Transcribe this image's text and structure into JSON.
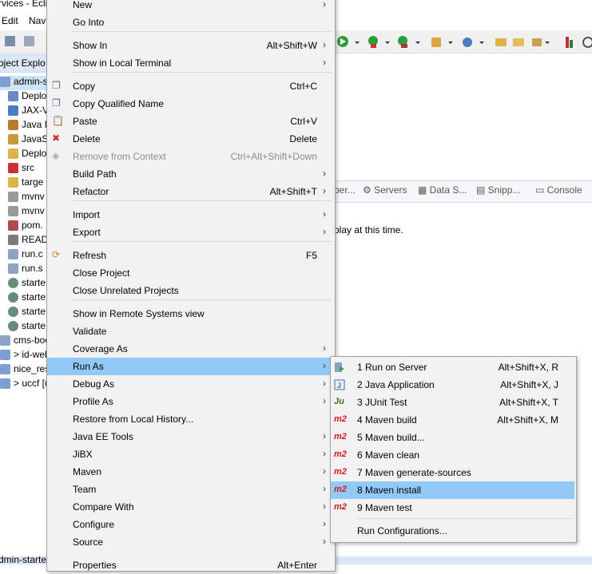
{
  "window": {
    "title": "rvices - Ecli"
  },
  "menubar": {
    "items": [
      "Edit",
      "Nav"
    ]
  },
  "explorer": {
    "title": "oject Explo",
    "rows": [
      "admin-st",
      "Deplo",
      "JAX-V",
      "Java I",
      "JavaS",
      "Deplo",
      "src",
      "targe",
      "mvnv",
      "mvnv",
      "pom.",
      "READ",
      "run.c",
      "run.s",
      "starte",
      "starte",
      "starte",
      "starte",
      "cms-boo",
      "> id-web",
      "nice_rest",
      "> uccf [u"
    ],
    "bottom_row": "dmin-starte"
  },
  "bottom_panel": {
    "tabs": [
      "per...",
      "Servers",
      "Data S...",
      "Snipp...",
      "Console"
    ],
    "message": "play at this time."
  },
  "context_menu": {
    "items": [
      {
        "label": "New",
        "submenu": true
      },
      {
        "label": "Go Into"
      },
      {
        "label": "Show In",
        "accel": "Alt+Shift+W",
        "submenu": true
      },
      {
        "label": "Show in Local Terminal",
        "submenu": true
      },
      {
        "label": "Copy",
        "accel": "Ctrl+C",
        "icon": "copy-icon"
      },
      {
        "label": "Copy Qualified Name",
        "icon": "copy-icon"
      },
      {
        "label": "Paste",
        "accel": "Ctrl+V",
        "icon": "paste-icon"
      },
      {
        "label": "Delete",
        "accel": "Delete",
        "icon": "delete-icon"
      },
      {
        "label": "Remove from Context",
        "accel": "Ctrl+Alt+Shift+Down",
        "disabled": true,
        "icon": "remove-context-icon"
      },
      {
        "label": "Build Path",
        "submenu": true
      },
      {
        "label": "Refactor",
        "accel": "Alt+Shift+T",
        "submenu": true
      },
      {
        "label": "Import",
        "submenu": true
      },
      {
        "label": "Export",
        "submenu": true
      },
      {
        "label": "Refresh",
        "accel": "F5",
        "icon": "refresh-icon"
      },
      {
        "label": "Close Project"
      },
      {
        "label": "Close Unrelated Projects"
      },
      {
        "label": "Show in Remote Systems view"
      },
      {
        "label": "Validate"
      },
      {
        "label": "Coverage As",
        "submenu": true
      },
      {
        "label": "Run As",
        "submenu": true,
        "selected": true
      },
      {
        "label": "Debug As",
        "submenu": true
      },
      {
        "label": "Profile As",
        "submenu": true
      },
      {
        "label": "Restore from Local History..."
      },
      {
        "label": "Java EE Tools",
        "submenu": true
      },
      {
        "label": "JiBX",
        "submenu": true
      },
      {
        "label": "Maven",
        "submenu": true
      },
      {
        "label": "Team",
        "submenu": true
      },
      {
        "label": "Compare With",
        "submenu": true
      },
      {
        "label": "Configure",
        "submenu": true
      },
      {
        "label": "Source",
        "submenu": true
      },
      {
        "label": "Properties",
        "accel": "Alt+Enter"
      }
    ]
  },
  "run_as_menu": {
    "items": [
      {
        "label": "1 Run on Server",
        "accel": "Alt+Shift+X, R",
        "icon": "server-icon"
      },
      {
        "label": "2 Java Application",
        "accel": "Alt+Shift+X, J",
        "icon": "java-app-icon"
      },
      {
        "label": "3 JUnit Test",
        "accel": "Alt+Shift+X, T",
        "icon": "junit-icon",
        "icon_text": "Ju"
      },
      {
        "label": "4 Maven build",
        "accel": "Alt+Shift+X, M",
        "icon": "maven-icon",
        "icon_text": "m2"
      },
      {
        "label": "5 Maven build...",
        "icon": "maven-icon",
        "icon_text": "m2"
      },
      {
        "label": "6 Maven clean",
        "icon": "maven-icon",
        "icon_text": "m2"
      },
      {
        "label": "7 Maven generate-sources",
        "icon": "maven-icon",
        "icon_text": "m2"
      },
      {
        "label": "8 Maven install",
        "icon": "maven-icon",
        "icon_text": "m2",
        "selected": true
      },
      {
        "label": "9 Maven test",
        "icon": "maven-icon",
        "icon_text": "m2"
      },
      {
        "label": "Run Configurations..."
      }
    ]
  },
  "colors": {
    "selection": "#91c9f7",
    "menu_bg": "#f2f2f2",
    "maven_red": "#d21919"
  }
}
